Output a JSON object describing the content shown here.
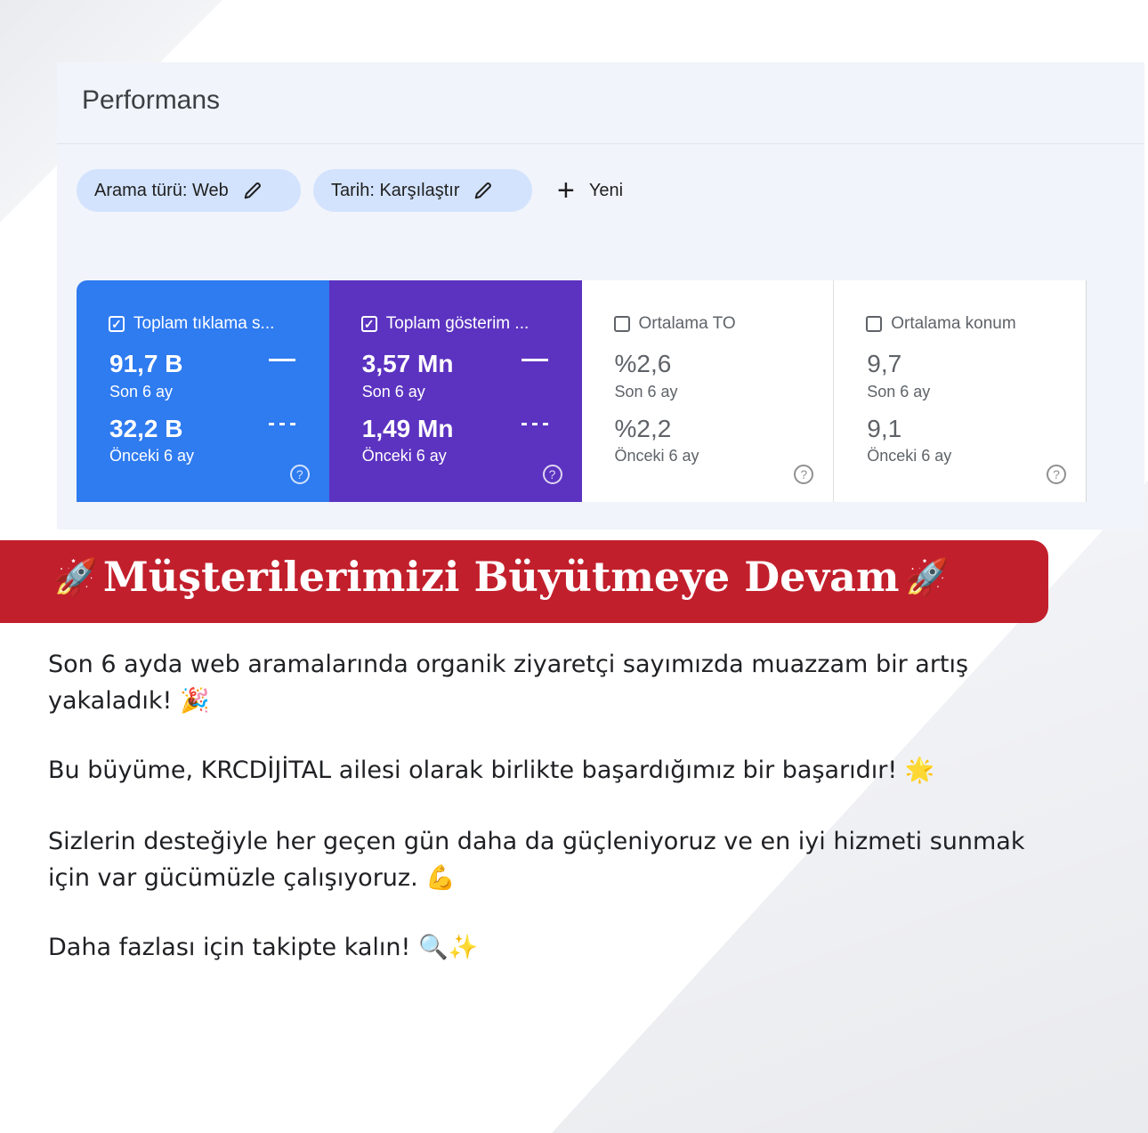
{
  "panel": {
    "title": "Performans",
    "chips": [
      {
        "label": "Arama türü: Web",
        "icon": "pencil-icon"
      },
      {
        "label": "Tarih: Karşılaştır",
        "icon": "pencil-icon"
      }
    ],
    "new_label": "Yeni"
  },
  "cards": [
    {
      "title": "Toplam tıklama s...",
      "checked": true,
      "value_current": "91,7 B",
      "label_current": "Son 6 ay",
      "value_previous": "32,2 B",
      "label_previous": "Önceki 6 ay",
      "color": "#2f7bf0"
    },
    {
      "title": "Toplam gösterim ...",
      "checked": true,
      "value_current": "3,57 Mn",
      "label_current": "Son 6 ay",
      "value_previous": "1,49 Mn",
      "label_previous": "Önceki 6 ay",
      "color": "#5c33c0"
    },
    {
      "title": "Ortalama TO",
      "checked": false,
      "value_current": "%2,6",
      "label_current": "Son 6 ay",
      "value_previous": "%2,2",
      "label_previous": "Önceki 6 ay",
      "color": "#ffffff"
    },
    {
      "title": "Ortalama konum",
      "checked": false,
      "value_current": "9,7",
      "label_current": "Son 6 ay",
      "value_previous": "9,1",
      "label_previous": "Önceki 6 ay",
      "color": "#ffffff"
    }
  ],
  "banner": {
    "text": "Müşterilerimizi Büyütmeye Devam",
    "emoji": "🚀",
    "color": "#c21f2c"
  },
  "paragraphs": [
    "Son 6 ayda web aramalarında organik ziyaretçi sayımızda muazzam bir artış yakaladık! 🎉",
    "Bu büyüme, KRCDİJİTAL ailesi olarak birlikte başardığımız bir başarıdır! 🌟",
    "Sizlerin desteğiyle her geçen gün daha da güçleniyoruz ve en iyi hizmeti sunmak için var gücümüzle çalışıyoruz. 💪",
    "Daha fazlası için takipte kalın! 🔍✨"
  ]
}
